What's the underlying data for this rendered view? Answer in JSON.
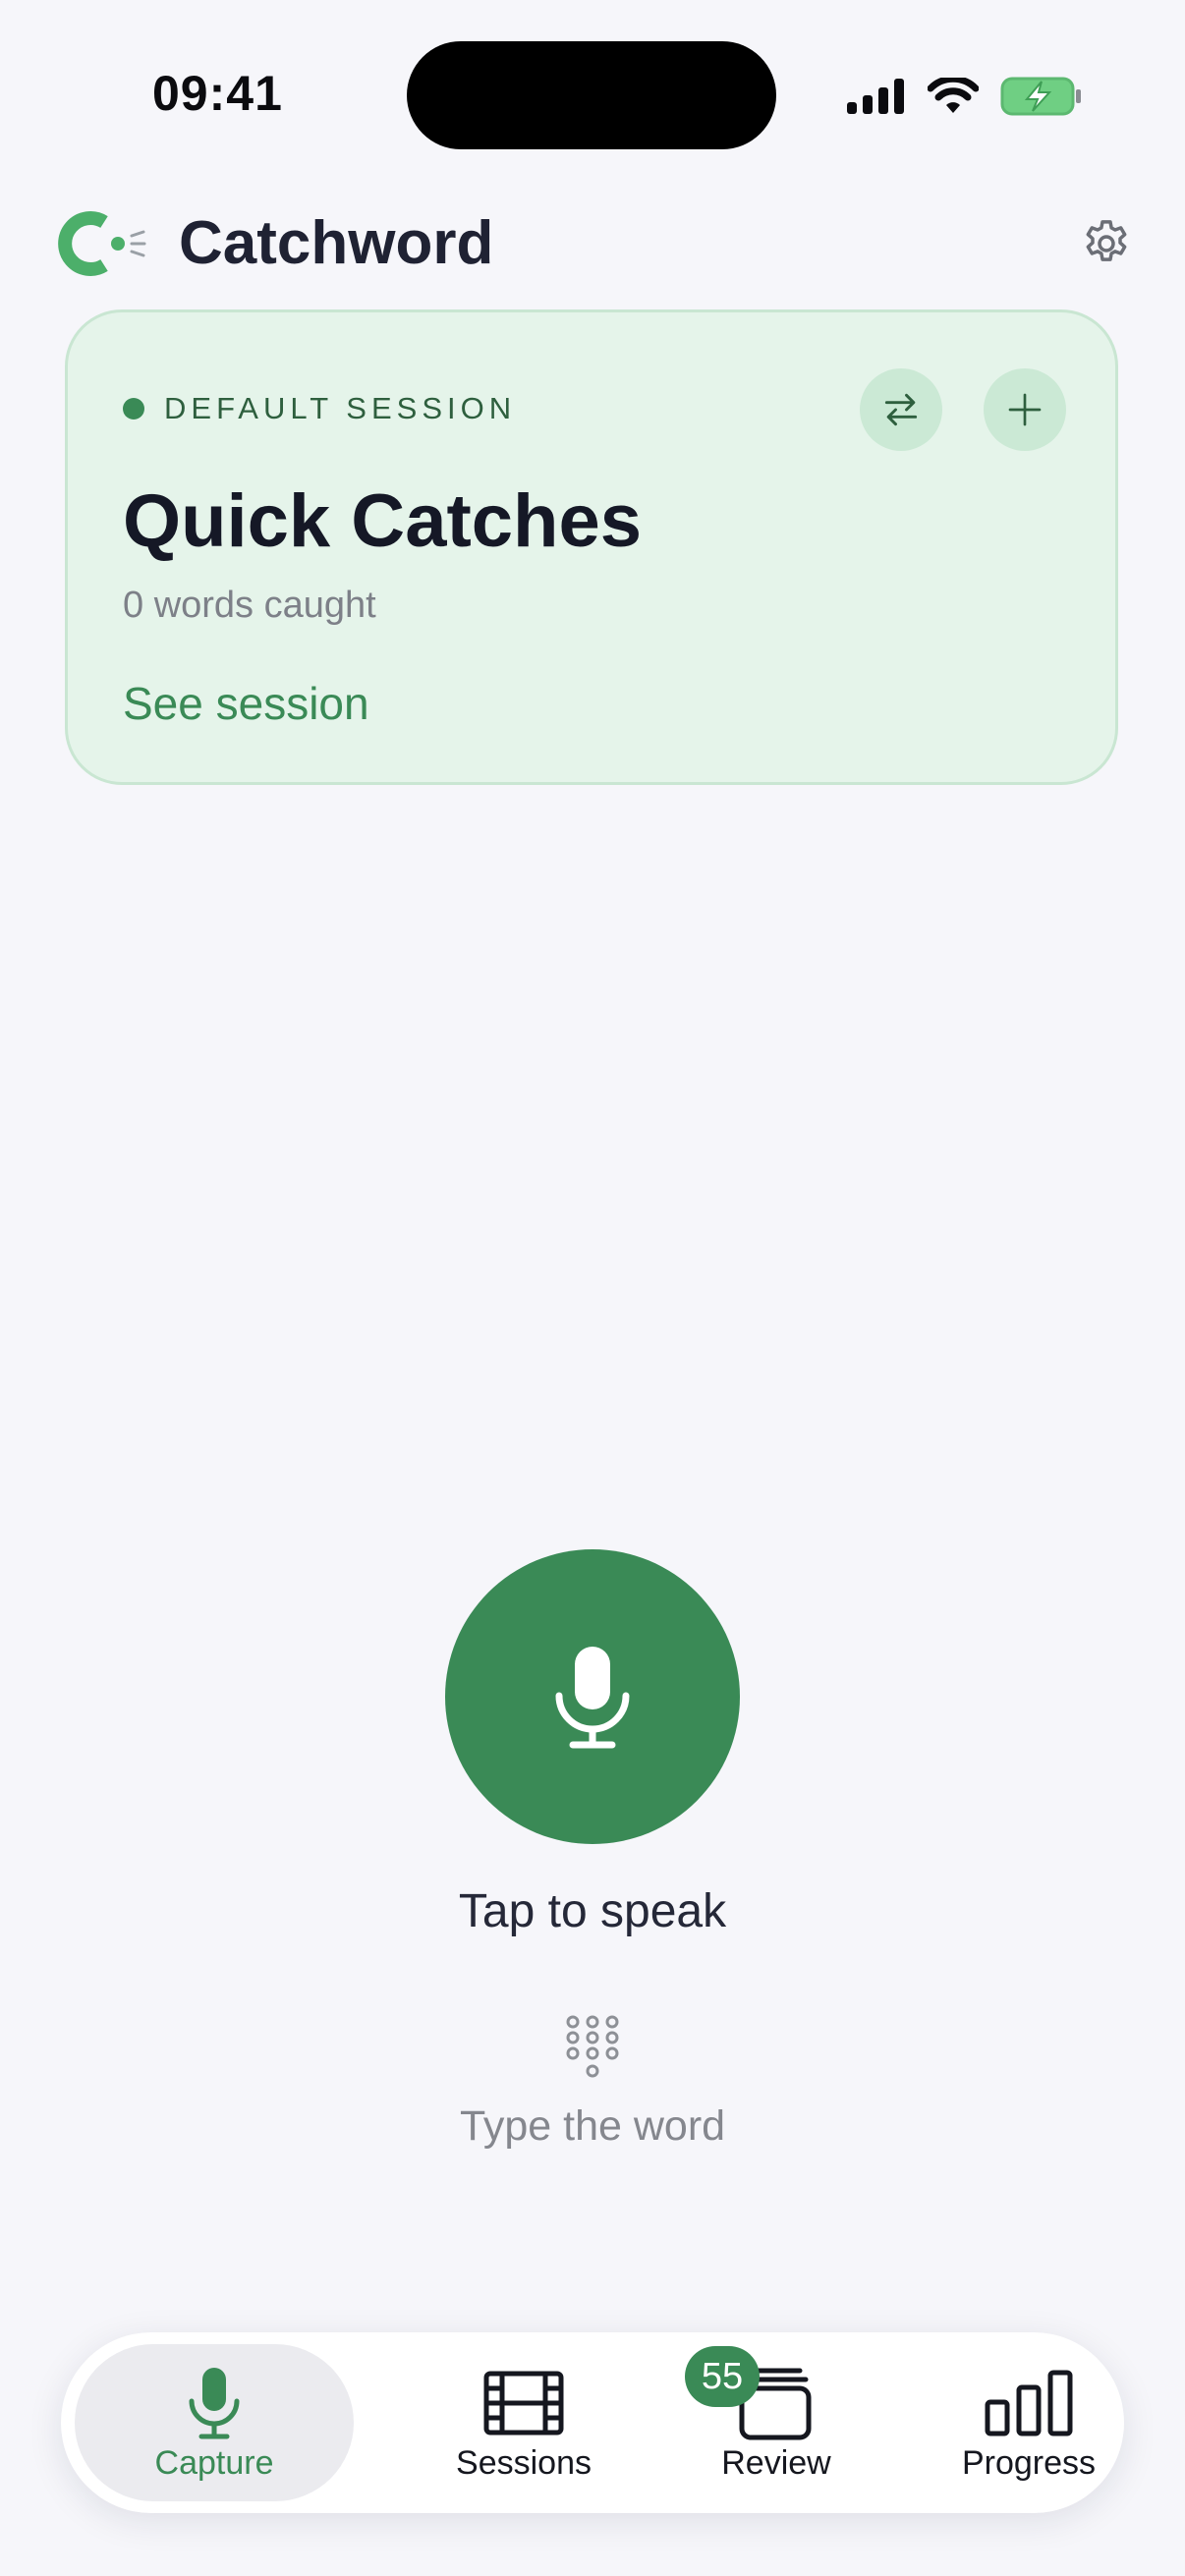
{
  "status_bar": {
    "time": "09:41",
    "icons": [
      "cellular-signal-icon",
      "wifi-icon",
      "battery-charging-icon"
    ]
  },
  "header": {
    "app_name": "Catchword",
    "logo_icon": "catchword-logo-icon",
    "settings_icon": "gear-icon"
  },
  "session_card": {
    "eyebrow": "DEFAULT SESSION",
    "title": "Quick Catches",
    "word_count": "0 words caught",
    "link": "See session",
    "actions": [
      "swap-icon",
      "plus-icon"
    ]
  },
  "capture": {
    "mic_label": "Tap to speak",
    "type_label": "Type the word"
  },
  "tab_bar": {
    "tabs": [
      {
        "label": "Capture",
        "icon": "microphone-icon",
        "active": true
      },
      {
        "label": "Sessions",
        "icon": "film-strip-icon",
        "active": false
      },
      {
        "label": "Review",
        "icon": "card-stack-icon",
        "active": false
      },
      {
        "label": "Progress",
        "icon": "bar-chart-icon",
        "active": false
      }
    ],
    "review_badge": "55"
  },
  "colors": {
    "accent": "#3a8a56",
    "card_background": "#e5f4ea",
    "page_background": "#f6f6fa"
  }
}
